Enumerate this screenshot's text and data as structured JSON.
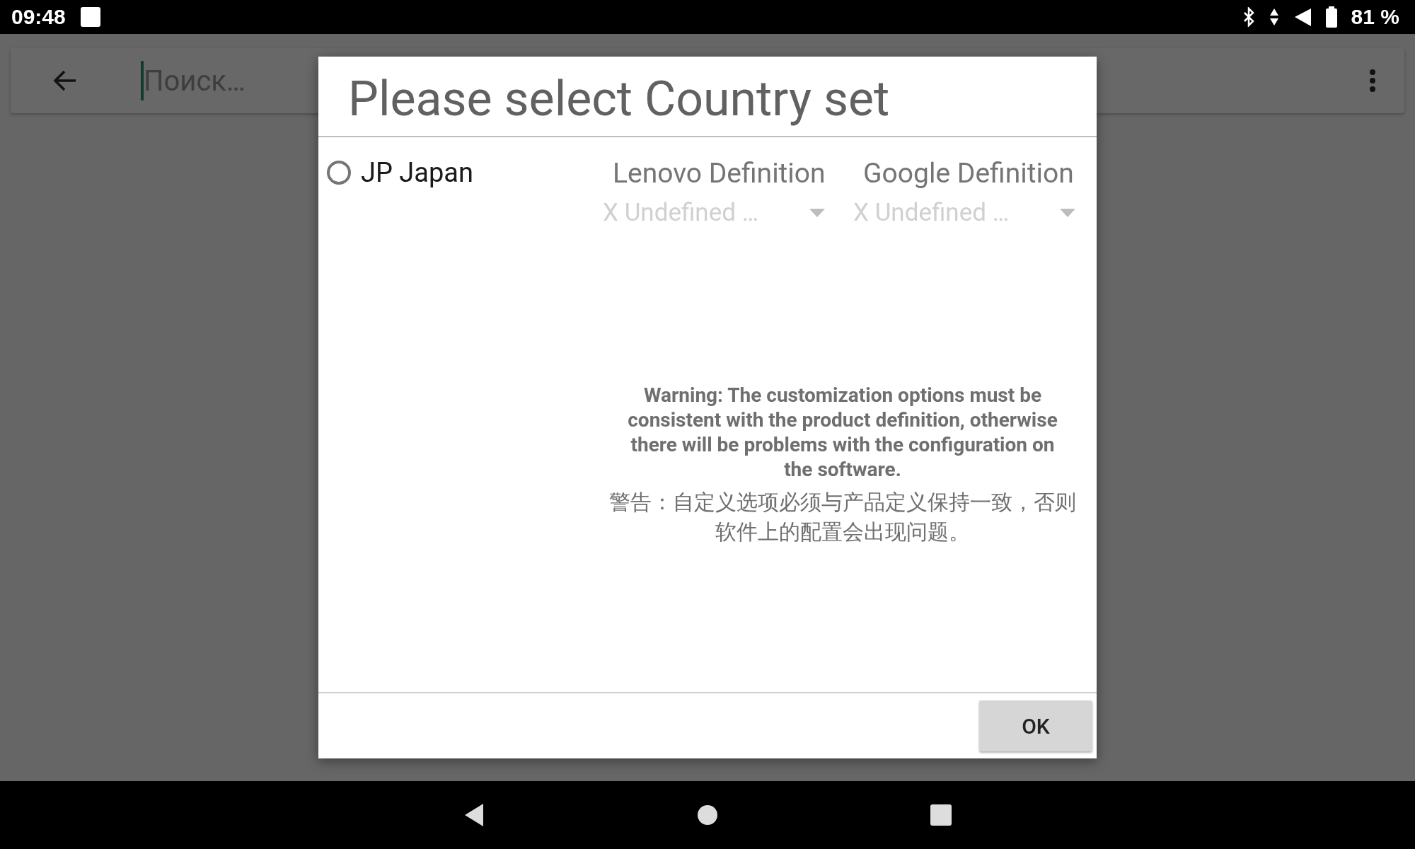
{
  "status_bar": {
    "time": "09:48",
    "battery": "81 %"
  },
  "search_bar": {
    "placeholder": "Поиск…"
  },
  "dialog": {
    "title": "Please select Country set",
    "option": {
      "label": "JP Japan",
      "selected": false
    },
    "definitions": [
      {
        "header": "Lenovo Definition",
        "value": "X Undefined …",
        "disabled": true
      },
      {
        "header": "Google Definition",
        "value": "X Undefined …",
        "disabled": true
      }
    ],
    "warning": "Warning: The customization options must be consistent with the product definition, otherwise there will be problems with the configuration on the software.",
    "warning_zh": "警告：自定义选项必须与产品定义保持一致，否则软件上的配置会出现问题。",
    "buttons": [
      "OK"
    ]
  }
}
